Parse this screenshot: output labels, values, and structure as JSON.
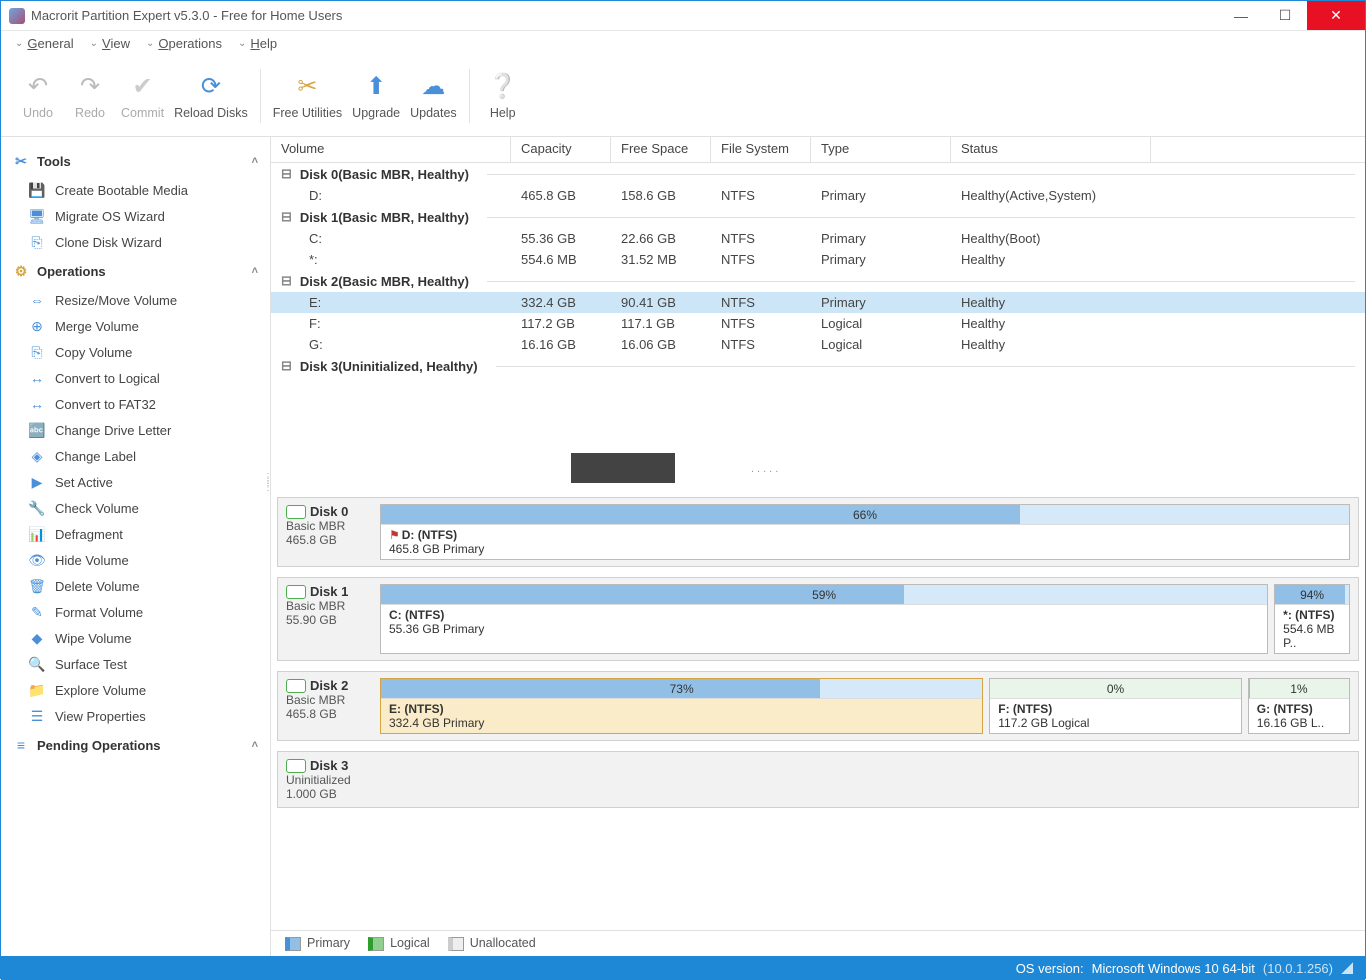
{
  "title": "Macrorit Partition Expert v5.3.0 - Free for Home Users",
  "menu": {
    "general": "General",
    "view": "View",
    "operations": "Operations",
    "help": "Help"
  },
  "toolbar": {
    "undo": "Undo",
    "redo": "Redo",
    "commit": "Commit",
    "reload": "Reload Disks",
    "utilities": "Free Utilities",
    "upgrade": "Upgrade",
    "updates": "Updates",
    "help": "Help"
  },
  "sidebar": {
    "tools_hdr": "Tools",
    "tools": [
      "Create Bootable Media",
      "Migrate OS Wizard",
      "Clone Disk Wizard"
    ],
    "ops_hdr": "Operations",
    "ops": [
      "Resize/Move Volume",
      "Merge Volume",
      "Copy Volume",
      "Convert to Logical",
      "Convert to FAT32",
      "Change Drive Letter",
      "Change Label",
      "Set Active",
      "Check Volume",
      "Defragment",
      "Hide Volume",
      "Delete Volume",
      "Format Volume",
      "Wipe Volume",
      "Surface Test",
      "Explore Volume",
      "View Properties"
    ],
    "pending_hdr": "Pending Operations"
  },
  "cols": {
    "volume": "Volume",
    "capacity": "Capacity",
    "free": "Free Space",
    "fs": "File System",
    "type": "Type",
    "status": "Status"
  },
  "disks": [
    {
      "hdr": "Disk 0(Basic MBR, Healthy)",
      "rows": [
        {
          "vol": "D:",
          "cap": "465.8 GB",
          "free": "158.6 GB",
          "fs": "NTFS",
          "type": "Primary",
          "status": "Healthy(Active,System)"
        }
      ]
    },
    {
      "hdr": "Disk 1(Basic MBR, Healthy)",
      "rows": [
        {
          "vol": "C:",
          "cap": "55.36 GB",
          "free": "22.66 GB",
          "fs": "NTFS",
          "type": "Primary",
          "status": "Healthy(Boot)"
        },
        {
          "vol": "*:",
          "cap": "554.6 MB",
          "free": "31.52 MB",
          "fs": "NTFS",
          "type": "Primary",
          "status": "Healthy"
        }
      ]
    },
    {
      "hdr": "Disk 2(Basic MBR, Healthy)",
      "rows": [
        {
          "vol": "E:",
          "cap": "332.4 GB",
          "free": "90.41 GB",
          "fs": "NTFS",
          "type": "Primary",
          "status": "Healthy",
          "sel": true
        },
        {
          "vol": "F:",
          "cap": "117.2 GB",
          "free": "117.1 GB",
          "fs": "NTFS",
          "type": "Logical",
          "status": "Healthy"
        },
        {
          "vol": "G:",
          "cap": "16.16 GB",
          "free": "16.06 GB",
          "fs": "NTFS",
          "type": "Logical",
          "status": "Healthy"
        }
      ]
    },
    {
      "hdr": "Disk 3(Uninitialized, Healthy)",
      "rows": []
    }
  ],
  "graphical": [
    {
      "name": "Disk 0",
      "type": "Basic MBR",
      "size": "465.8 GB",
      "parts": [
        {
          "pct": "66%",
          "fill": 66,
          "label": "D: (NTFS)",
          "sub": "465.8 GB Primary",
          "flag": true,
          "flex": 1
        }
      ]
    },
    {
      "name": "Disk 1",
      "type": "Basic MBR",
      "size": "55.90 GB",
      "parts": [
        {
          "pct": "59%",
          "fill": 59,
          "label": "C: (NTFS)",
          "sub": "55.36 GB Primary",
          "flex": 12
        },
        {
          "pct": "94%",
          "fill": 94,
          "label": "*: (NTFS)",
          "sub": "554.6 MB P..",
          "flex": 1
        }
      ]
    },
    {
      "name": "Disk 2",
      "type": "Basic MBR",
      "size": "465.8 GB",
      "parts": [
        {
          "pct": "73%",
          "fill": 73,
          "label": "E: (NTFS)",
          "sub": "332.4 GB Primary",
          "sel": true,
          "flex": 6
        },
        {
          "pct": "0%",
          "fill": 0,
          "label": "F: (NTFS)",
          "sub": "117.2 GB Logical",
          "green": true,
          "flex": 2.5
        },
        {
          "pct": "1%",
          "fill": 1,
          "label": "G: (NTFS)",
          "sub": "16.16 GB L..",
          "green": true,
          "flex": 1
        }
      ]
    },
    {
      "name": "Disk 3",
      "type": "Uninitialized",
      "size": "1.000 GB",
      "parts": []
    }
  ],
  "legend": {
    "primary": "Primary",
    "logical": "Logical",
    "unalloc": "Unallocated"
  },
  "statusbar": {
    "prefix": "OS version:",
    "os": "Microsoft Windows 10  64-bit",
    "build": "(10.0.1.256)"
  }
}
